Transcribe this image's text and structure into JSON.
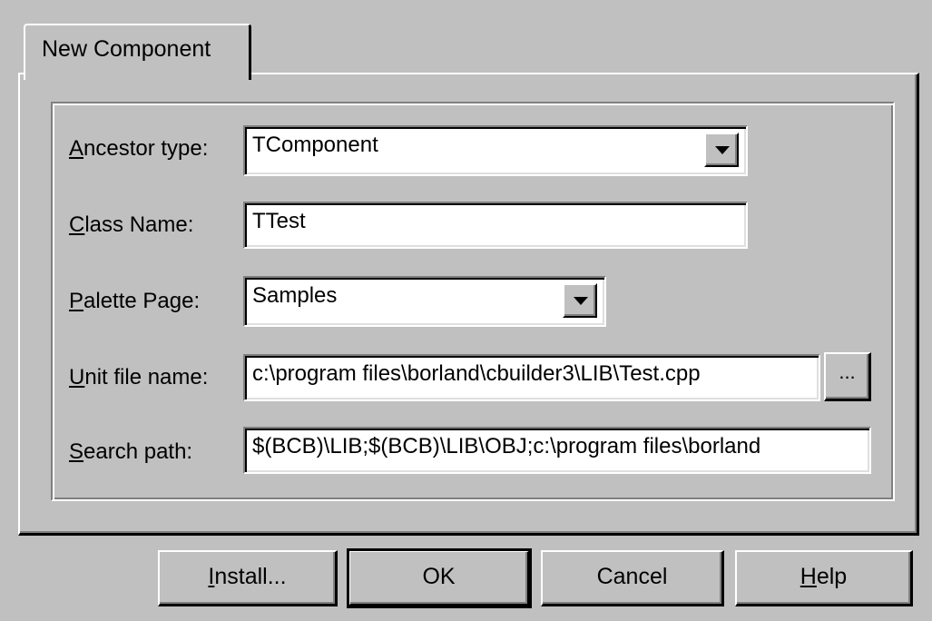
{
  "tab": {
    "label": "New Component"
  },
  "form": {
    "ancestor_type": {
      "label_accel": "A",
      "label_rest": "ncestor type:",
      "value": "TComponent",
      "dropdown_icon": "chevron-down-icon"
    },
    "class_name": {
      "label_accel": "C",
      "label_rest": "lass Name:",
      "value": "TTest"
    },
    "palette_page": {
      "label_accel": "P",
      "label_rest": "alette Page:",
      "value": "Samples",
      "dropdown_icon": "chevron-down-icon"
    },
    "unit_file_name": {
      "label_accel": "U",
      "label_rest": "nit file name:",
      "value": "c:\\program files\\borland\\cbuilder3\\LIB\\Test.cpp",
      "browse_label": "..."
    },
    "search_path": {
      "label_accel": "S",
      "label_rest": "earch path:",
      "value": "$(BCB)\\LIB;$(BCB)\\LIB\\OBJ;c:\\program files\\borland"
    }
  },
  "buttons": {
    "install": {
      "accel": "I",
      "rest": "nstall..."
    },
    "ok": {
      "label": "OK"
    },
    "cancel": {
      "label": "Cancel"
    },
    "help": {
      "accel": "H",
      "rest": "elp"
    }
  },
  "colors": {
    "face": "#c0c0c0",
    "highlight": "#ffffff",
    "shadow": "#808080",
    "dark_shadow": "#000000",
    "field_bg": "#ffffff"
  }
}
